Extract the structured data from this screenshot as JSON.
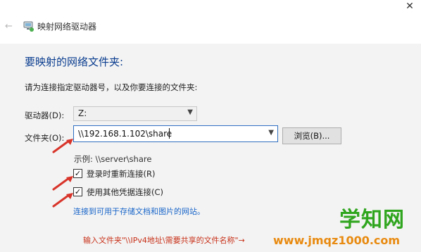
{
  "window": {
    "title": "映射网络驱动器",
    "close_icon": "close-icon",
    "back_icon": "back-arrow-icon",
    "app_icon": "network-drive-icon"
  },
  "dialog": {
    "heading": "要映射的网络文件夹:",
    "instructions": "请为连接指定驱动器号，以及你要连接的文件夹:",
    "drive_label": "驱动器(D):",
    "drive_value": "Z:",
    "folder_label": "文件夹(O):",
    "folder_value": "\\\\192.168.1.102\\share",
    "browse_label": "浏览(B)...",
    "example": "示例: \\\\server\\share",
    "reconnect_label": "登录时重新连接(R)",
    "reconnect_checked": true,
    "other_credentials_label": "使用其他凭据连接(C)",
    "other_credentials_checked": true,
    "link_text": "连接到可用于存储文档和图片的网站。"
  },
  "annotation": {
    "text": "输入文件夹\"\\\\IPv4地址\\需要共享的文件名称\"→",
    "color": "#c8321a"
  },
  "watermark": {
    "text": "学知网",
    "url": "www.jmqz1000.com",
    "text_color": "#2fa51e",
    "url_color": "#e88a10"
  }
}
